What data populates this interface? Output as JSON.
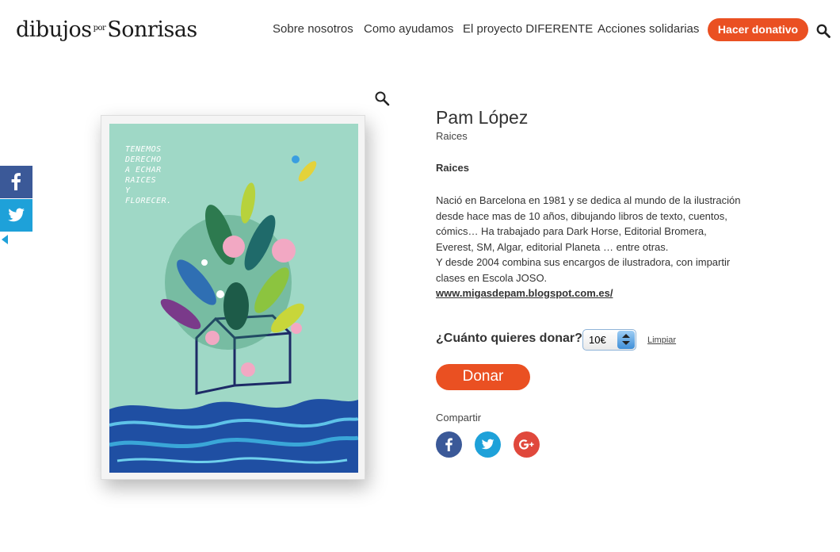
{
  "header": {
    "logo": {
      "text_main": "dibujos",
      "text_por": "por",
      "text_end": "Sonrisas"
    },
    "nav": [
      "Sobre nosotros",
      "Como ayudamos",
      "El proyecto DIFERENTE",
      "Acciones solidarias"
    ],
    "donate_label": "Hacer donativo"
  },
  "poster": {
    "lines": [
      "TENEMOS",
      "DERECHO",
      "A ECHAR",
      "RAICES",
      "Y",
      "FLORECER."
    ]
  },
  "product": {
    "title": "Pam López",
    "subtitle": "Raices",
    "bold_label": "Raices",
    "description": [
      "Nació en Barcelona en 1981 y se dedica al mundo de la ilustración",
      "desde hace mas de 10 años, dibujando libros de texto, cuentos,",
      "cómics… Ha trabajado para Dark Horse, Editorial Bromera,",
      "Everest, SM, Algar, editorial Planeta … entre otras.",
      "Y desde 2004 combina sus encargos de ilustradora, con impartir",
      "clases en Escola JOSO."
    ],
    "link": "www.migasdepam.blogspot.com.es/"
  },
  "donation": {
    "question": "¿Cuánto quieres donar?",
    "amount": "10€",
    "clear_label": "Limpiar",
    "button_label": "Donar"
  },
  "share": {
    "label": "Compartir",
    "buttons": [
      "facebook-icon",
      "twitter-icon",
      "google-plus-icon"
    ]
  },
  "colors": {
    "accent": "#ea5022",
    "facebook": "#3b5998",
    "twitter": "#1ea1d9",
    "google_plus": "#e0483c"
  }
}
